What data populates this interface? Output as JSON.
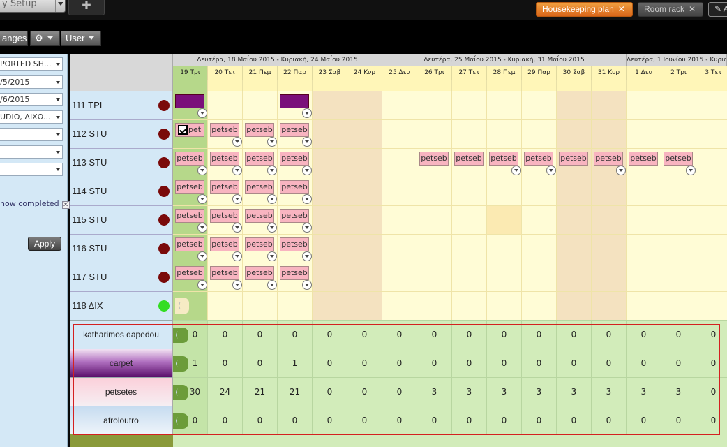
{
  "topbar": {
    "setup_label": "y Setup",
    "tabs": [
      {
        "label": "Housekeeping plan",
        "close": "✕"
      },
      {
        "label": "Room rack",
        "close": "✕"
      },
      {
        "label": "A",
        "icon": "edit-icon"
      }
    ]
  },
  "toolbar": {
    "changes_label": "anges",
    "settings_icon": "gear-icon",
    "user_label": "User"
  },
  "sidebar": {
    "fields": [
      "PORTED SH...",
      "/5/2015",
      "/6/2015",
      "UDIO, ΔΙΧΩ...",
      "",
      "",
      ""
    ],
    "show_completed": "how completed",
    "apply_label": "Apply"
  },
  "weeks": [
    "Δευτέρα, 18 Μαΐου 2015 - Κυριακή, 24 Μαΐου 2015",
    "Δευτέρα, 25 Μαΐου 2015 - Κυριακή, 31 Μαΐου 2015",
    "Δευτέρα, 1 Ιουνίου 2015 - Κυριακ"
  ],
  "days": [
    "19 Τρι",
    "20 Τετ",
    "21 Πεμ",
    "22 Παρ",
    "23 Σαβ",
    "24 Κυρ",
    "25 Δευ",
    "26 Τρι",
    "27 Τετ",
    "28 Πεμ",
    "29 Παρ",
    "30 Σαβ",
    "31 Κυρ",
    "1 Δευ",
    "2 Τρι",
    "3 Τετ"
  ],
  "rooms": [
    {
      "label": "111  ΤΡΙ",
      "status": "dirty",
      "tasks": {
        "0": "carpet",
        "3": "carpet"
      }
    },
    {
      "label": "112  STU",
      "status": "dirty",
      "tasks": {
        "0": "pet",
        "1": "petseb",
        "2": "petseb",
        "3": "petseb"
      }
    },
    {
      "label": "113  STU",
      "status": "dirty",
      "tasks": {
        "0": "petseb",
        "1": "petseb",
        "2": "petseb",
        "3": "petseb",
        "7": "petseb",
        "8": "petseb",
        "9": "petseb",
        "10": "petseb",
        "11": "petseb",
        "12": "petseb",
        "13": "petseb",
        "14": "petseb"
      }
    },
    {
      "label": "114  STU",
      "status": "dirty",
      "tasks": {
        "0": "petseb",
        "1": "petseb",
        "2": "petseb",
        "3": "petseb"
      }
    },
    {
      "label": "115  STU",
      "status": "dirty",
      "tasks": {
        "0": "petseb",
        "1": "petseb",
        "2": "petseb",
        "3": "petseb"
      }
    },
    {
      "label": "116  STU",
      "status": "dirty",
      "tasks": {
        "0": "petseb",
        "1": "petseb",
        "2": "petseb",
        "3": "petseb"
      }
    },
    {
      "label": "117  STU",
      "status": "dirty",
      "tasks": {
        "0": "petseb",
        "1": "petseb",
        "2": "petseb",
        "3": "petseb"
      }
    },
    {
      "label": "118  ΔΙΧ",
      "status": "clean",
      "tasks": {}
    }
  ],
  "summary": [
    {
      "label": "katharimos dapedou",
      "style": "plain",
      "values": [
        "0",
        "0",
        "0",
        "0",
        "0",
        "0",
        "0",
        "0",
        "0",
        "0",
        "0",
        "0",
        "0",
        "0",
        "0",
        "0"
      ]
    },
    {
      "label": "carpet",
      "style": "purple",
      "values": [
        "1",
        "0",
        "0",
        "1",
        "0",
        "0",
        "0",
        "0",
        "0",
        "0",
        "0",
        "0",
        "0",
        "0",
        "0",
        "0"
      ]
    },
    {
      "label": "petsetes",
      "style": "pink",
      "values": [
        "30",
        "24",
        "21",
        "21",
        "0",
        "0",
        "0",
        "3",
        "3",
        "3",
        "3",
        "3",
        "3",
        "3",
        "3",
        "0"
      ]
    },
    {
      "label": "afroloutro",
      "style": "blue",
      "values": [
        "0",
        "0",
        "0",
        "0",
        "0",
        "0",
        "0",
        "0",
        "0",
        "0",
        "0",
        "0",
        "0",
        "0",
        "0",
        "0"
      ]
    }
  ],
  "colors": {
    "accent_tab": "#e07a20",
    "dirty_dot": "#7a0a0a",
    "clean_dot": "#33dd22",
    "highlight_frame": "#d42020"
  }
}
